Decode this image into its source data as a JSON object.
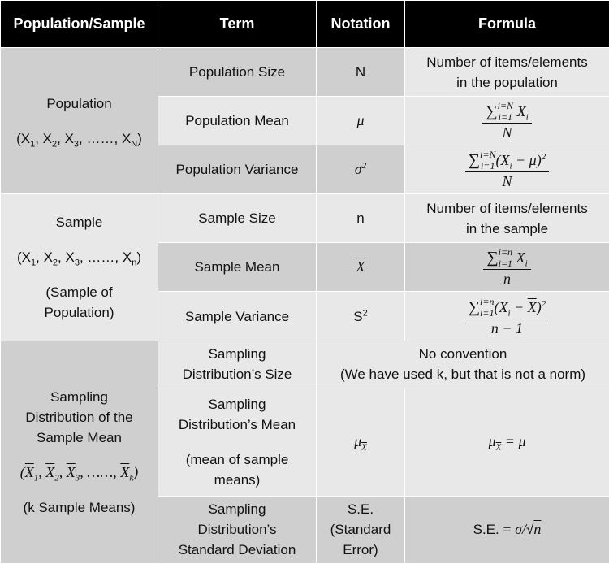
{
  "headers": [
    "Population/Sample",
    "Term",
    "Notation",
    "Formula"
  ],
  "population": {
    "title": "Population",
    "set": "(X₁, X₂, X₃, ……, Xₙ)",
    "size": {
      "term": "Population Size",
      "notation": "N",
      "formula_line1": "Number of items/elements",
      "formula_line2": "in the population"
    },
    "mean": {
      "term": "Population Mean",
      "notation": "μ",
      "formula_num": "X",
      "formula_den": "N",
      "limit_top": "i=N",
      "limit_bottom": "i=1",
      "sub": "i"
    },
    "variance": {
      "term": "Population Variance",
      "notation": "σ",
      "notation_sup": "2",
      "formula_num": "(X",
      "formula_num_rest": " − μ)",
      "formula_den": "N",
      "limit_top": "i=N",
      "limit_bottom": "i=1"
    }
  },
  "sample": {
    "title": "Sample",
    "set": "(X₁, X₂, X₃, ……, Xₙ)",
    "note_line1": "(Sample of",
    "note_line2": "Population)",
    "size": {
      "term": "Sample Size",
      "notation": "n",
      "formula_line1": "Number of items/elements",
      "formula_line2": "in the sample"
    },
    "mean": {
      "term": "Sample Mean",
      "notation": "X",
      "formula_num": "X",
      "formula_den": "n",
      "limit_top": "i=n",
      "limit_bottom": "i=1"
    },
    "variance": {
      "term": "Sample Variance",
      "notation": "S",
      "notation_sup": "2",
      "formula_num": "(X",
      "formula_num_mid": " − ",
      "formula_num_end": ")",
      "formula_den": "n − 1",
      "limit_top": "i=n",
      "limit_bottom": "i=1"
    }
  },
  "sampling": {
    "title_line1": "Sampling",
    "title_line2": "Distribution of the",
    "title_line3": "Sample Mean",
    "set": "(X̄₁, X̄₂, X̄₃, ……, X̄ₖ)",
    "note": "(k Sample Means)",
    "size": {
      "term_line1": "Sampling",
      "term_line2": "Distribution’s Size",
      "formula_line1": "No convention",
      "formula_line2": "(We have used k, but that is not a norm)"
    },
    "mean": {
      "term_line1": "Sampling",
      "term_line2": "Distribution’s Mean",
      "term_line3": "(mean of sample",
      "term_line4": "means)",
      "notation": "μ",
      "notation_sub": "X",
      "formula_lhs": "μ",
      "formula_rhs": "μ",
      "formula_eq": "="
    },
    "sd": {
      "term_line1": "Sampling",
      "term_line2": "Distribution’s",
      "term_line3": "Standard Deviation",
      "notation_line1": "S.E.",
      "notation_line2": "(Standard",
      "notation_line3": "Error)",
      "formula_prefix": "S.E. = ",
      "formula_sigma": "σ",
      "formula_slash": "/",
      "formula_sqrt": "√",
      "formula_n": "n"
    }
  }
}
